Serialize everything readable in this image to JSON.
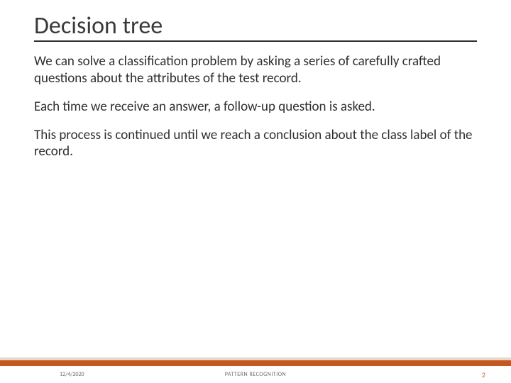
{
  "title": "Decision tree",
  "paragraphs": {
    "p1": "We can solve a classification problem by asking a series of carefully crafted questions about the attributes of the test record.",
    "p2": "Each time we receive an answer, a follow-up question is asked.",
    "p3": "This process is continued until we reach a conclusion about the class label of the record."
  },
  "footer": {
    "date": "12/4/2020",
    "center": "PATTERN RECOGNITION",
    "page": "2"
  }
}
